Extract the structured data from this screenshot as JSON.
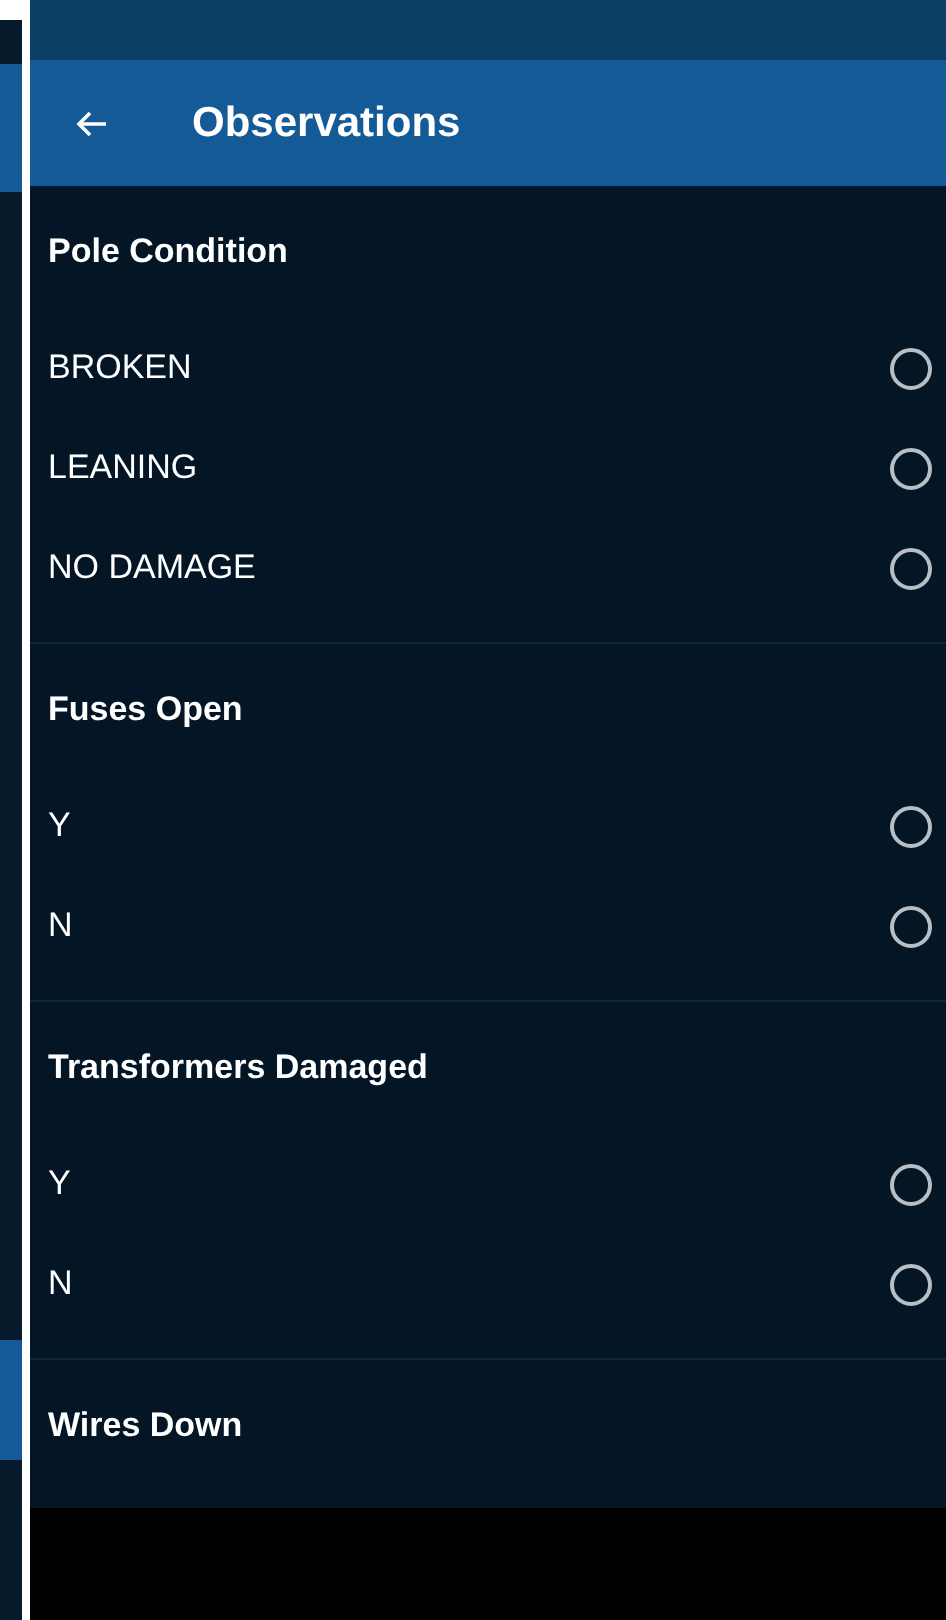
{
  "app_bar": {
    "title": "Observations"
  },
  "sections": [
    {
      "title": "Pole Condition",
      "options": [
        {
          "label": "BROKEN",
          "selected": false
        },
        {
          "label": "LEANING",
          "selected": false
        },
        {
          "label": "NO DAMAGE",
          "selected": false
        }
      ]
    },
    {
      "title": "Fuses Open",
      "options": [
        {
          "label": "Y",
          "selected": false
        },
        {
          "label": "N",
          "selected": false
        }
      ]
    },
    {
      "title": "Transformers Damaged",
      "options": [
        {
          "label": "Y",
          "selected": false
        },
        {
          "label": "N",
          "selected": false
        }
      ]
    },
    {
      "title": "Wires Down"
    }
  ]
}
